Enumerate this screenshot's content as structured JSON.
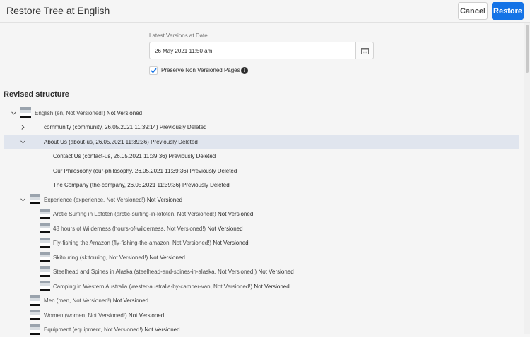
{
  "header": {
    "title": "Restore Tree at English",
    "cancel_label": "Cancel",
    "restore_label": "Restore"
  },
  "form": {
    "date_label": "Latest Versions at Date",
    "date_value": "26 May 2021 11:50 am",
    "calendar_icon": "calendar-icon",
    "preserve_label": "Preserve Non Versioned Pages",
    "preserve_checked": true,
    "info_icon": "info-icon"
  },
  "section": {
    "title": "Revised structure"
  },
  "tree": [
    {
      "name": "English (en, Not Versioned!)",
      "status": "Not Versioned",
      "chevron": "down",
      "thumb": true
    },
    {
      "name": "community (community, 26.05.2021 11:39:14)",
      "status": "Previously Deleted",
      "chevron": "right",
      "thumb": false
    },
    {
      "name": "About Us (about-us, 26.05.2021 11:39:36)",
      "status": "Previously Deleted",
      "chevron": "down",
      "thumb": false,
      "selected": true
    },
    {
      "name": "Contact Us (contact-us, 26.05.2021 11:39:36)",
      "status": "Previously Deleted",
      "chevron": "",
      "thumb": false
    },
    {
      "name": "Our Philosophy (our-philosophy, 26.05.2021 11:39:36)",
      "status": "Previously Deleted",
      "chevron": "",
      "thumb": false
    },
    {
      "name": "The Company (the-company, 26.05.2021 11:39:36)",
      "status": "Previously Deleted",
      "chevron": "",
      "thumb": false
    },
    {
      "name": "Experience (experience, Not Versioned!)",
      "status": "Not Versioned",
      "chevron": "down",
      "thumb": true
    },
    {
      "name": "Arctic Surfing in Lofoten (arctic-surfing-in-lofoten, Not Versioned!)",
      "status": "Not Versioned",
      "chevron": "",
      "thumb": true
    },
    {
      "name": "48 hours of Wilderness (hours-of-wilderness, Not Versioned!)",
      "status": "Not Versioned",
      "chevron": "",
      "thumb": true
    },
    {
      "name": "Fly-fishing the Amazon (fly-fishing-the-amazon, Not Versioned!)",
      "status": "Not Versioned",
      "chevron": "",
      "thumb": true
    },
    {
      "name": "Skitouring (skitouring, Not Versioned!)",
      "status": "Not Versioned",
      "chevron": "",
      "thumb": true
    },
    {
      "name": "Steelhead and Spines in Alaska (steelhead-and-spines-in-alaska, Not Versioned!)",
      "status": "Not Versioned",
      "chevron": "",
      "thumb": true
    },
    {
      "name": "Camping in Western Australia (wester-australia-by-camper-van, Not Versioned!)",
      "status": "Not Versioned",
      "chevron": "",
      "thumb": true
    },
    {
      "name": "Men (men, Not Versioned!)",
      "status": "Not Versioned",
      "chevron": "",
      "thumb": true
    },
    {
      "name": "Women (women, Not Versioned!)",
      "status": "Not Versioned",
      "chevron": "",
      "thumb": true
    },
    {
      "name": "Equipment (equipment, Not Versioned!)",
      "status": "Not Versioned",
      "chevron": "",
      "thumb": true
    }
  ]
}
